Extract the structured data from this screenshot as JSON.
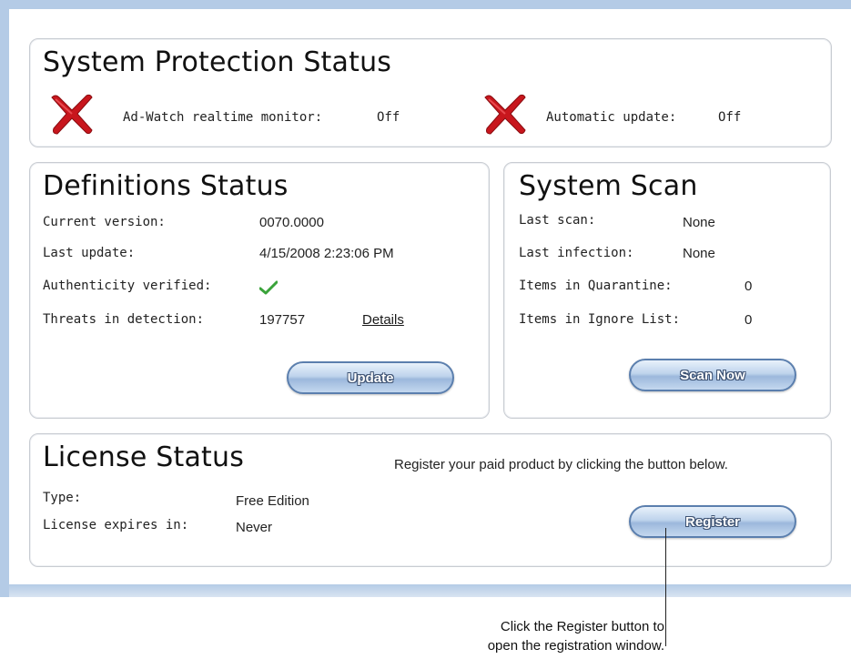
{
  "protection": {
    "title": "System Protection Status",
    "realtime_label": "Ad-Watch realtime monitor:",
    "realtime_value": "Off",
    "update_label": "Automatic update:",
    "update_value": "Off",
    "status_icon": "red-x-icon",
    "status_color": "#c8161d"
  },
  "definitions": {
    "title": "Definitions Status",
    "version_label": "Current version:",
    "version_value": "0070.0000",
    "last_update_label": "Last update:",
    "last_update_value": "4/15/2008 2:23:06 PM",
    "authenticity_label": "Authenticity verified:",
    "authenticity_icon": "green-check-icon",
    "threats_label": "Threats in detection:",
    "threats_value": "197757",
    "details_link": "Details",
    "update_button": "Update"
  },
  "scan": {
    "title": "System Scan",
    "last_scan_label": "Last scan:",
    "last_scan_value": "None",
    "last_infection_label": "Last infection:",
    "last_infection_value": "None",
    "quarantine_label": "Items in Quarantine:",
    "quarantine_value": "0",
    "ignore_label": "Items in Ignore List:",
    "ignore_value": "0",
    "scan_button": "Scan Now"
  },
  "license": {
    "title": "License Status",
    "register_prompt": "Register your paid product by clicking the button below.",
    "type_label": "Type:",
    "type_value": "Free Edition",
    "expires_label": "License expires in:",
    "expires_value": "Never",
    "register_button": "Register"
  },
  "annotation": {
    "line1": "Click the Register button to",
    "line2": "open the registration window."
  },
  "colors": {
    "frame_blue": "#b4cbe6",
    "button_border": "#5b7fae",
    "check_green": "#3aa33a"
  }
}
